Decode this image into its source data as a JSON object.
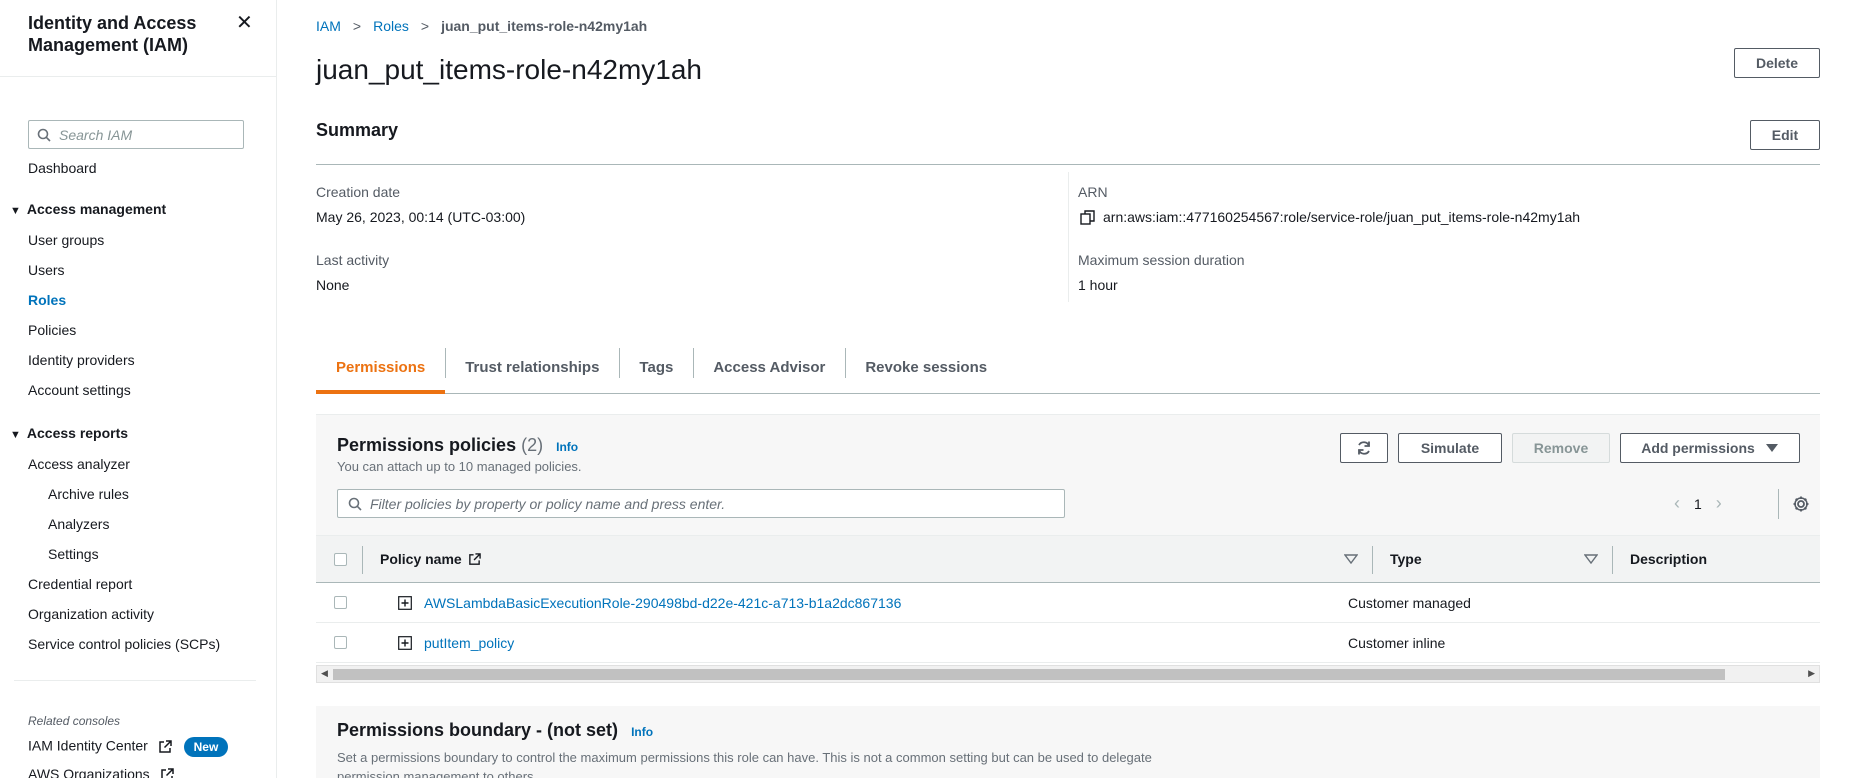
{
  "sidebar": {
    "title": "Identity and Access Management (IAM)",
    "search_placeholder": "Search IAM",
    "dashboard": "Dashboard",
    "access_management": {
      "label": "Access management",
      "items": [
        "User groups",
        "Users",
        "Roles",
        "Policies",
        "Identity providers",
        "Account settings"
      ],
      "active": "Roles"
    },
    "access_reports": {
      "label": "Access reports",
      "access_analyzer": "Access analyzer",
      "analyzer_items": [
        "Archive rules",
        "Analyzers",
        "Settings"
      ],
      "items": [
        "Credential report",
        "Organization activity",
        "Service control policies (SCPs)"
      ]
    },
    "related_consoles_label": "Related consoles",
    "iam_identity_center": "IAM Identity Center",
    "new_badge": "New",
    "aws_organizations": "AWS Organizations"
  },
  "breadcrumb": {
    "items": [
      "IAM",
      "Roles"
    ],
    "current": "juan_put_items-role-n42my1ah"
  },
  "page": {
    "title": "juan_put_items-role-n42my1ah",
    "delete_label": "Delete"
  },
  "summary": {
    "title": "Summary",
    "edit_label": "Edit",
    "creation_date_label": "Creation date",
    "creation_date": "May 26, 2023, 00:14 (UTC-03:00)",
    "last_activity_label": "Last activity",
    "last_activity": "None",
    "arn_label": "ARN",
    "arn": "arn:aws:iam::477160254567:role/service-role/juan_put_items-role-n42my1ah",
    "max_session_label": "Maximum session duration",
    "max_session": "1 hour"
  },
  "tabs": [
    "Permissions",
    "Trust relationships",
    "Tags",
    "Access Advisor",
    "Revoke sessions"
  ],
  "active_tab": "Permissions",
  "permissions": {
    "title": "Permissions policies",
    "count": "(2)",
    "info": "Info",
    "subtitle": "You can attach up to 10 managed policies.",
    "simulate_label": "Simulate",
    "remove_label": "Remove",
    "add_permissions_label": "Add permissions",
    "filter_placeholder": "Filter policies by property or policy name and press enter.",
    "page_number": "1",
    "columns": {
      "policy_name": "Policy name",
      "type": "Type",
      "description": "Description"
    },
    "rows": [
      {
        "name": "AWSLambdaBasicExecutionRole-290498bd-d22e-421c-a713-b1a2dc867136",
        "type": "Customer managed"
      },
      {
        "name": "putItem_policy",
        "type": "Customer inline"
      }
    ]
  },
  "boundary": {
    "title": "Permissions boundary - (not set)",
    "info": "Info",
    "description": "Set a permissions boundary to control the maximum permissions this role can have. This is not a common setting but can be used to delegate permission management to others."
  },
  "colors": {
    "link": "#0073bb",
    "active_tab": "#ec7211",
    "text": "#16191f",
    "muted": "#687078"
  }
}
